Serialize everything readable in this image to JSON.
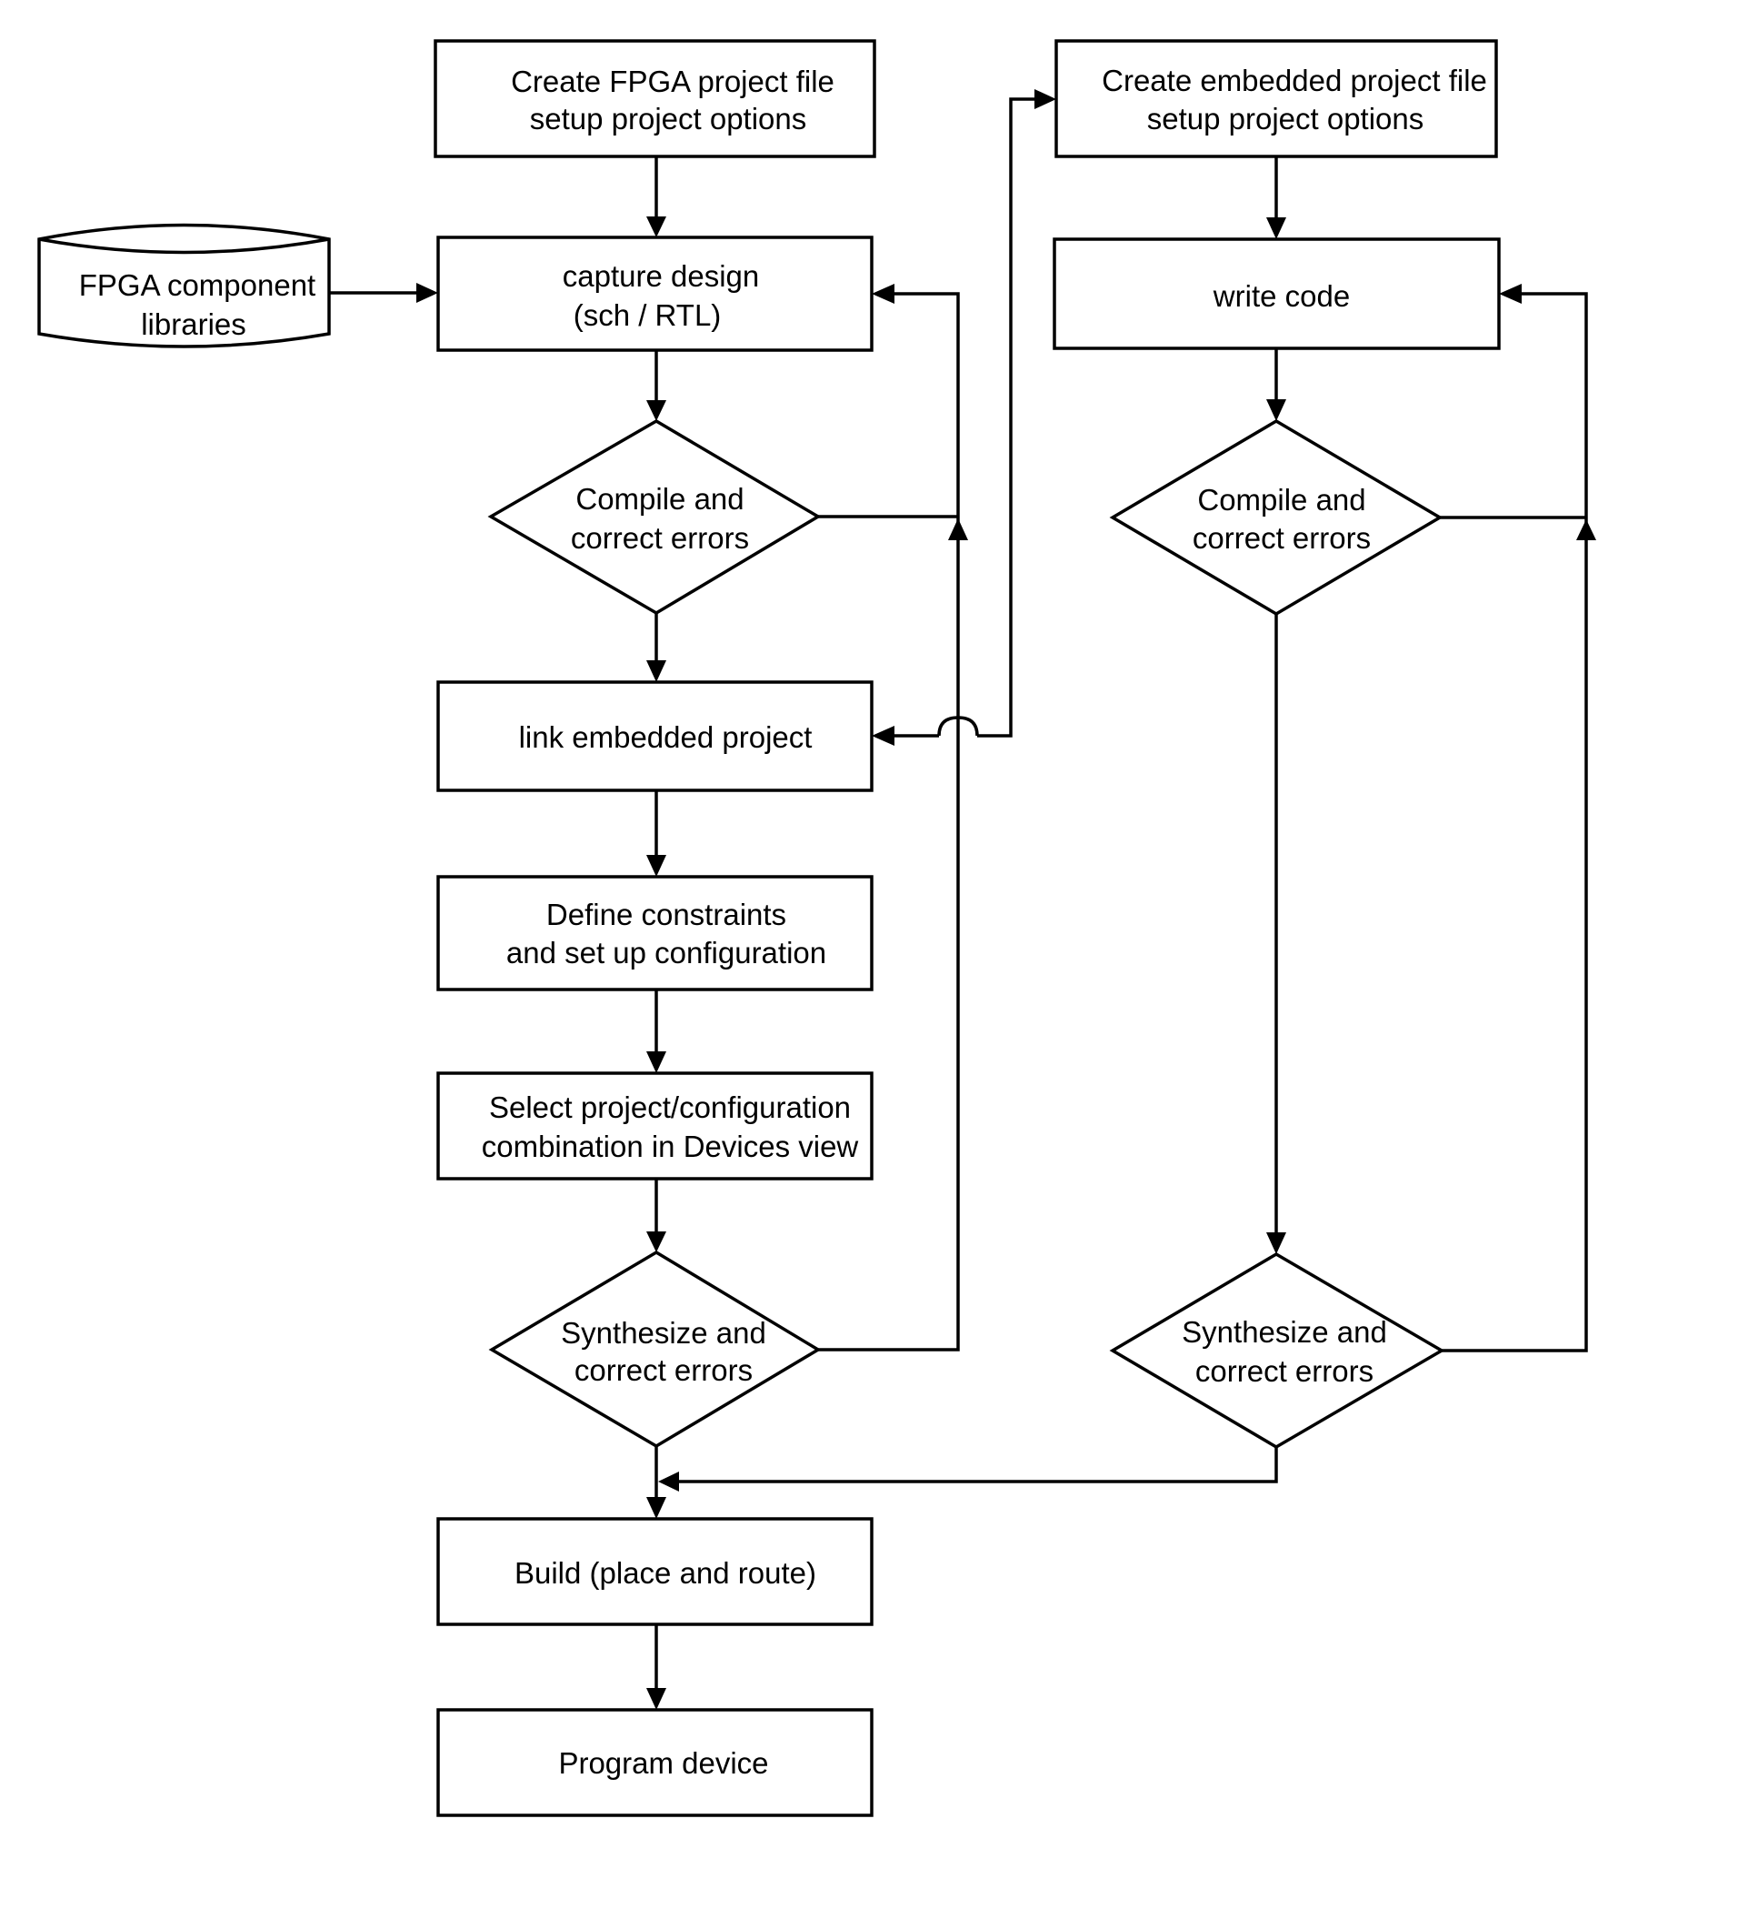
{
  "diagram": {
    "type": "flowchart",
    "nodes": {
      "create_fpga_project": {
        "lines": [
          "Create FPGA project file",
          "setup project options"
        ]
      },
      "fpga_component_libraries": {
        "lines": [
          "FPGA component",
          "libraries"
        ]
      },
      "capture_design": {
        "lines": [
          "capture design",
          "(sch / RTL)"
        ]
      },
      "compile_fpga": {
        "lines": [
          "Compile and",
          "correct errors"
        ]
      },
      "link_embedded_project": {
        "lines": [
          "link embedded project"
        ]
      },
      "define_constraints": {
        "lines": [
          "Define constraints",
          "and set up configuration"
        ]
      },
      "select_combination": {
        "lines": [
          "Select project/configuration",
          "combination in Devices view"
        ]
      },
      "synthesize_fpga": {
        "lines": [
          "Synthesize and",
          "correct errors"
        ]
      },
      "build": {
        "lines": [
          "Build (place and route)"
        ]
      },
      "program_device": {
        "lines": [
          "Program device"
        ]
      },
      "create_embedded_project": {
        "lines": [
          "Create embedded project file",
          "setup project options"
        ]
      },
      "write_code": {
        "lines": [
          "write code"
        ]
      },
      "compile_embedded": {
        "lines": [
          "Compile and",
          "correct errors"
        ]
      },
      "synthesize_embedded": {
        "lines": [
          "Synthesize and",
          "correct errors"
        ]
      }
    },
    "edges": [
      [
        "create_fpga_project",
        "capture_design"
      ],
      [
        "fpga_component_libraries",
        "capture_design"
      ],
      [
        "capture_design",
        "compile_fpga"
      ],
      [
        "compile_fpga",
        "capture_design"
      ],
      [
        "compile_fpga",
        "link_embedded_project"
      ],
      [
        "link_embedded_project",
        "create_embedded_project"
      ],
      [
        "create_embedded_project",
        "link_embedded_project"
      ],
      [
        "link_embedded_project",
        "define_constraints"
      ],
      [
        "define_constraints",
        "select_combination"
      ],
      [
        "select_combination",
        "synthesize_fpga"
      ],
      [
        "synthesize_fpga",
        "capture_design"
      ],
      [
        "synthesize_fpga",
        "build"
      ],
      [
        "build",
        "program_device"
      ],
      [
        "create_embedded_project",
        "write_code"
      ],
      [
        "write_code",
        "compile_embedded"
      ],
      [
        "compile_embedded",
        "write_code"
      ],
      [
        "compile_embedded",
        "synthesize_embedded"
      ],
      [
        "synthesize_embedded",
        "write_code"
      ],
      [
        "synthesize_embedded",
        "build"
      ]
    ]
  }
}
